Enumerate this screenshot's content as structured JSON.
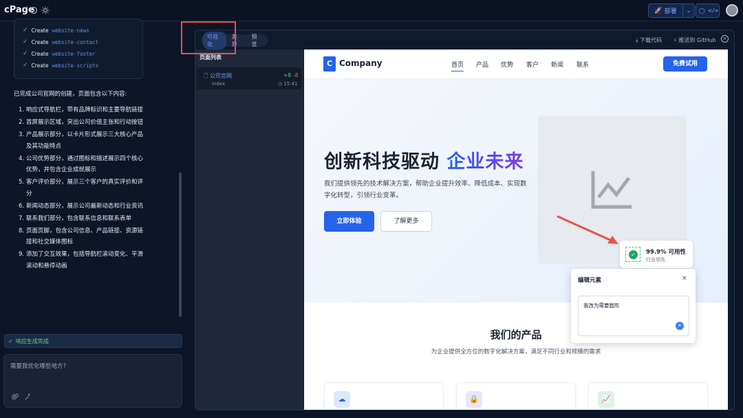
{
  "app": {
    "logo": "cPage"
  },
  "topbar": {
    "deploy_label": "部署"
  },
  "chat": {
    "steps": [
      {
        "verb": "Create",
        "target": "website-news"
      },
      {
        "verb": "Create",
        "target": "website-contact"
      },
      {
        "verb": "Create",
        "target": "website-footer"
      },
      {
        "verb": "Create",
        "target": "website-scripts"
      }
    ],
    "summary": "已完成公司官网的创建，页面包含以下内容:",
    "items": [
      {
        "n": "1.",
        "text": "响应式导航栏，带有品牌标识和主要导航链接"
      },
      {
        "n": "2.",
        "text": "首屏展示区域，突出公司价值主张和行动按钮"
      },
      {
        "n": "3.",
        "text": "产品展示部分，以卡片形式展示三大核心产品及其功能特点"
      },
      {
        "n": "4.",
        "text": "公司优势部分，通过图标和描述展示四个核心优势，并包含企业成就展示"
      },
      {
        "n": "5.",
        "text": "客户评价部分，展示三个客户的真实评价和评分"
      },
      {
        "n": "6.",
        "text": "新闻动态部分，展示公司最新动态和行业资讯"
      },
      {
        "n": "7.",
        "text": "联系我们部分，包含联系信息和联系表单"
      },
      {
        "n": "8.",
        "text": "页面页脚，包含公司信息、产品链接、资源链接和社交媒体图标"
      },
      {
        "n": "9.",
        "text": "添加了交互效果，包括导航栏滚动变化、平滑滚动和悬停动画"
      }
    ],
    "status": "响应生成完成",
    "input_placeholder": "需要我优化哪些地方?"
  },
  "workspace": {
    "tabs": [
      {
        "label": "可视化",
        "active": true
      },
      {
        "label": "差异",
        "active": false
      },
      {
        "label": "预览",
        "active": false
      }
    ],
    "download": "下载代码",
    "push_github": "推送到 GitHub",
    "page_list": {
      "title": "页面列表",
      "items": [
        {
          "name": "公司官网",
          "file": "index",
          "additions": "+8",
          "deletions": "-8",
          "time": "15:41"
        }
      ]
    }
  },
  "preview": {
    "brand_letter": "C",
    "brand_name": "Company",
    "nav": [
      "首页",
      "产品",
      "优势",
      "客户",
      "新闻",
      "联系"
    ],
    "cta": "免费试用",
    "hero": {
      "title_main": "创新科技驱动",
      "title_accent": "企业未来",
      "description": "我们提供领先的技术解决方案，帮助企业提升效率、降低成本、实现数字化转型，引领行业变革。",
      "primary_button": "立即体验",
      "secondary_button": "了解更多"
    },
    "badge": {
      "value": "99.9% 可用性",
      "label": "行业领先"
    },
    "edit_popup": {
      "title": "编辑元素",
      "text": "我改为需要圆形"
    },
    "products": {
      "title": "我们的产品",
      "subtitle": "为企业提供全方位的数字化解决方案，满足不同行业和规模的需求"
    }
  },
  "colors": {
    "accent": "#2563eb",
    "accent_purple": "#7c3aed",
    "success": "#23a55a",
    "danger": "#e25b5b",
    "annotation": "#e5544b"
  }
}
